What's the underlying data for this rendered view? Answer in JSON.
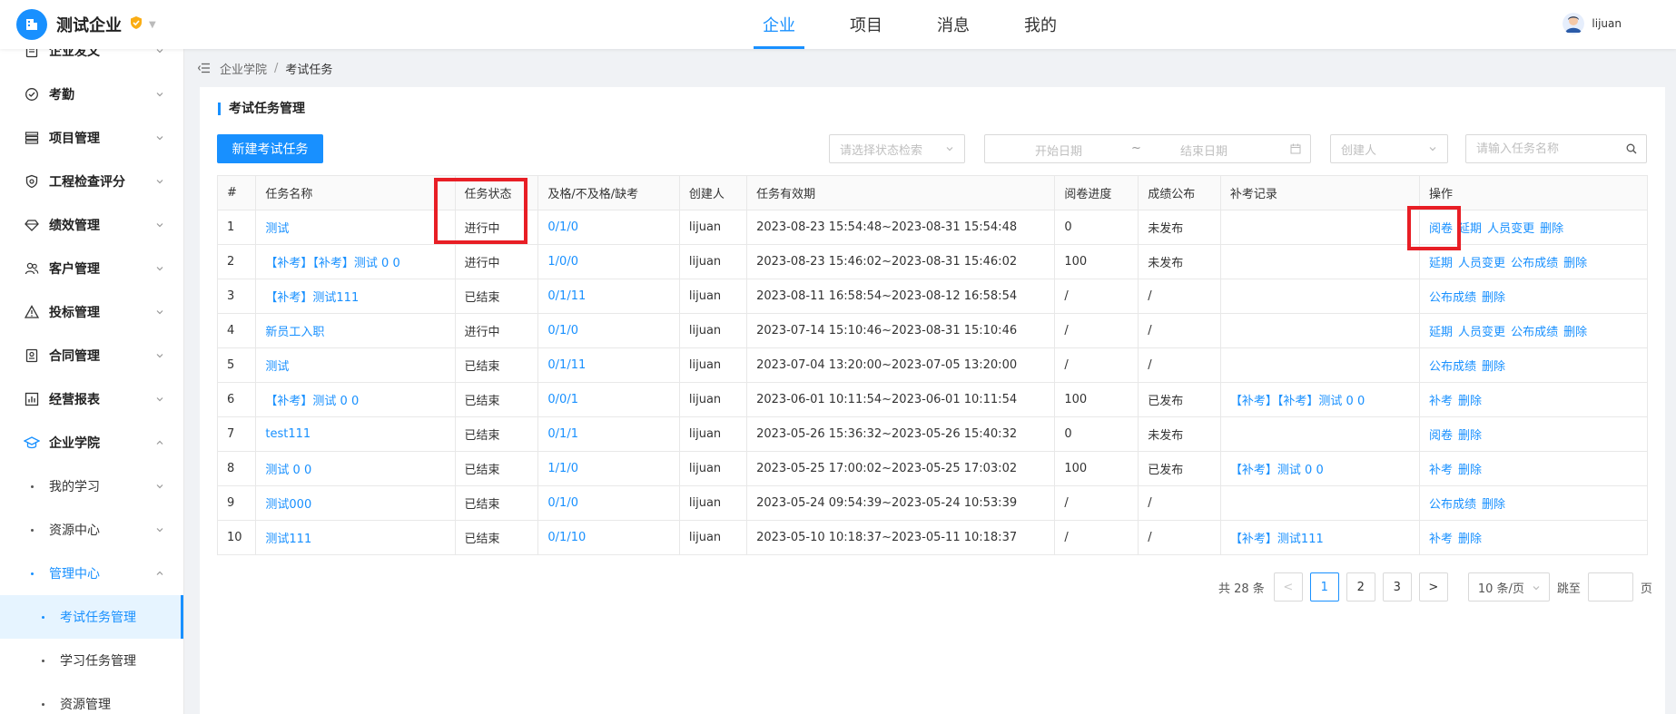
{
  "header": {
    "company": "测试企业",
    "nav": [
      "企业",
      "项目",
      "消息",
      "我的"
    ],
    "active_nav": 0,
    "username": "lijuan",
    "accent": "#1890ff"
  },
  "sidebar": {
    "menus": [
      {
        "label": "企业发文",
        "icon": "document-icon"
      },
      {
        "label": "考勤",
        "icon": "check-circle-icon"
      },
      {
        "label": "项目管理",
        "icon": "list-icon"
      },
      {
        "label": "工程检查评分",
        "icon": "shield-icon"
      },
      {
        "label": "绩效管理",
        "icon": "diamond-icon"
      },
      {
        "label": "客户管理",
        "icon": "users-icon"
      },
      {
        "label": "投标管理",
        "icon": "warning-icon"
      },
      {
        "label": "合同管理",
        "icon": "contract-icon"
      },
      {
        "label": "经营报表",
        "icon": "chart-icon"
      },
      {
        "label": "企业学院",
        "icon": "graduation-cap-icon"
      }
    ],
    "sub": [
      {
        "label": "我的学习"
      },
      {
        "label": "资源中心"
      },
      {
        "label": "管理中心"
      }
    ],
    "leaves": [
      {
        "label": "考试任务管理"
      },
      {
        "label": "学习任务管理"
      },
      {
        "label": "资源管理"
      }
    ]
  },
  "breadcrumb": {
    "items": [
      "企业学院",
      "考试任务"
    ],
    "separator": "/"
  },
  "page": {
    "title": "考试任务管理",
    "new_button": "新建考试任务",
    "filters": {
      "status_placeholder": "请选择状态检索",
      "start_date_placeholder": "开始日期",
      "date_separator": "~",
      "end_date_placeholder": "结束日期",
      "creator_placeholder": "创建人",
      "search_placeholder": "请输入任务名称"
    }
  },
  "table": {
    "columns": [
      "#",
      "任务名称",
      "任务状态",
      "及格/不及格/缺考",
      "创建人",
      "任务有效期",
      "阅卷进度",
      "成绩公布",
      "补考记录",
      "操作"
    ],
    "rows": [
      {
        "no": "1",
        "name": "测试",
        "status": "进行中",
        "pass": "0/1/0",
        "creator": "lijuan",
        "period": "2023-08-23 15:54:48~2023-08-31 15:54:48",
        "progress": "0",
        "publish": "未发布",
        "makeup": "",
        "actions": [
          "阅卷",
          "延期",
          "人员变更",
          "删除"
        ]
      },
      {
        "no": "2",
        "name": "【补考】【补考】测试 0 0",
        "status": "进行中",
        "pass": "1/0/0",
        "creator": "lijuan",
        "period": "2023-08-23 15:46:02~2023-08-31 15:46:02",
        "progress": "100",
        "publish": "未发布",
        "makeup": "",
        "actions": [
          "延期",
          "人员变更",
          "公布成绩",
          "删除"
        ]
      },
      {
        "no": "3",
        "name": "【补考】测试111",
        "status": "已结束",
        "pass": "0/1/11",
        "creator": "lijuan",
        "period": "2023-08-11 16:58:54~2023-08-12 16:58:54",
        "progress": "/",
        "publish": "/",
        "makeup": "",
        "actions": [
          "公布成绩",
          "删除"
        ]
      },
      {
        "no": "4",
        "name": "新员工入职",
        "status": "进行中",
        "pass": "0/1/0",
        "creator": "lijuan",
        "period": "2023-07-14 15:10:46~2023-08-31 15:10:46",
        "progress": "/",
        "publish": "/",
        "makeup": "",
        "actions": [
          "延期",
          "人员变更",
          "公布成绩",
          "删除"
        ]
      },
      {
        "no": "5",
        "name": "测试",
        "status": "已结束",
        "pass": "0/1/11",
        "creator": "lijuan",
        "period": "2023-07-04 13:20:00~2023-07-05 13:20:00",
        "progress": "/",
        "publish": "/",
        "makeup": "",
        "actions": [
          "公布成绩",
          "删除"
        ]
      },
      {
        "no": "6",
        "name": "【补考】测试 0 0",
        "status": "已结束",
        "pass": "0/0/1",
        "creator": "lijuan",
        "period": "2023-06-01 10:11:54~2023-06-01 10:11:54",
        "progress": "100",
        "publish": "已发布",
        "makeup": "【补考】【补考】测试 0 0",
        "actions": [
          "补考",
          "删除"
        ]
      },
      {
        "no": "7",
        "name": "test111",
        "status": "已结束",
        "pass": "0/1/1",
        "creator": "lijuan",
        "period": "2023-05-26 15:36:32~2023-05-26 15:40:32",
        "progress": "0",
        "publish": "未发布",
        "makeup": "",
        "actions": [
          "阅卷",
          "删除"
        ]
      },
      {
        "no": "8",
        "name": "测试 0 0",
        "status": "已结束",
        "pass": "1/1/0",
        "creator": "lijuan",
        "period": "2023-05-25 17:00:02~2023-05-25 17:03:02",
        "progress": "100",
        "publish": "已发布",
        "makeup": "【补考】测试 0 0",
        "actions": [
          "补考",
          "删除"
        ]
      },
      {
        "no": "9",
        "name": "测试000",
        "status": "已结束",
        "pass": "0/1/0",
        "creator": "lijuan",
        "period": "2023-05-24 09:54:39~2023-05-24 10:53:39",
        "progress": "/",
        "publish": "/",
        "makeup": "",
        "actions": [
          "公布成绩",
          "删除"
        ]
      },
      {
        "no": "10",
        "name": "测试111",
        "status": "已结束",
        "pass": "0/1/10",
        "creator": "lijuan",
        "period": "2023-05-10 10:18:37~2023-05-11 10:18:37",
        "progress": "/",
        "publish": "/",
        "makeup": "【补考】测试111",
        "actions": [
          "补考",
          "删除"
        ]
      }
    ]
  },
  "pagination": {
    "total_text": "共 28 条",
    "pages": [
      "1",
      "2",
      "3"
    ],
    "current": "1",
    "prev": "<",
    "next": ">",
    "page_size": "10 条/页",
    "jump_label": "跳至",
    "page_label": "页"
  },
  "highlight_color": "#e81e25"
}
